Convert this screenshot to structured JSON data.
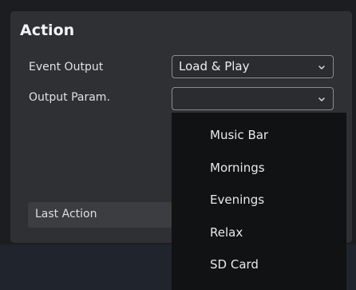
{
  "panel": {
    "title": "Action"
  },
  "event_output": {
    "label": "Event Output",
    "value": "Load & Play"
  },
  "output_param": {
    "label": "Output Param.",
    "value": ""
  },
  "last_action": {
    "label": "Last Action"
  },
  "dropdown": {
    "items": [
      {
        "label": "Music Bar"
      },
      {
        "label": "Mornings"
      },
      {
        "label": "Evenings"
      },
      {
        "label": "Relax"
      },
      {
        "label": "SD Card"
      }
    ]
  },
  "icons": {
    "chevron": "chevron-down-icon"
  },
  "colors": {
    "background": "#1b1d21",
    "panel": "#2e3033",
    "dropdown": "#111213",
    "border": "#8a8d92",
    "text": "#e6e8eb"
  }
}
